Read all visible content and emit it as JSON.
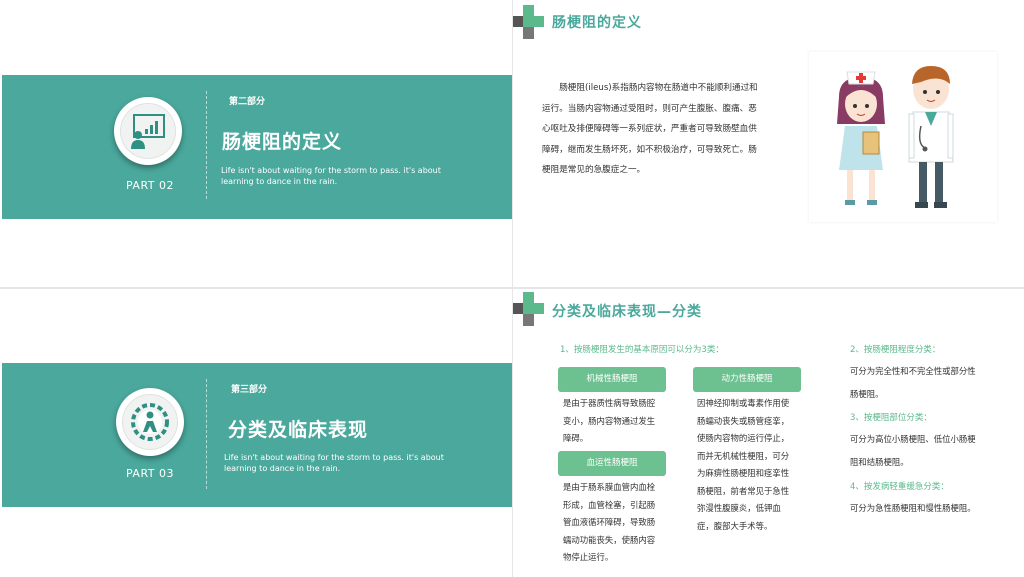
{
  "slide1": {
    "part": "PART 02",
    "label": "第二部分",
    "title": "肠梗阻的定义",
    "subtitle": "Life isn't about waiting for the storm to pass. it's about learning to dance in the rain.",
    "icon": "presenter-board-icon"
  },
  "slide2": {
    "title": "肠梗阻的定义",
    "paragraph": "肠梗阻(ileus)系指肠内容物在肠道中不能顺利通过和运行。当肠内容物通过受阻时，则可产生腹胀、腹痛、恶心呕吐及排便障碍等一系列症状，严重者可导致肠壁血供障碍，继而发生肠坏死，如不积极治疗，可导致死亡。肠梗阻是常见的急腹症之一。",
    "illustration": "nurse-and-doctor-illustration"
  },
  "slide3": {
    "part": "PART 03",
    "label": "第三部分",
    "title": "分类及临床表现",
    "subtitle": "Life isn't about waiting for the storm to pass. it's about learning to dance in the rain.",
    "icon": "person-gear-icon"
  },
  "slide4": {
    "title": "分类及临床表现—分类",
    "left_heading": "1、按肠梗阻发生的基本原因可以分为3类：",
    "pills": [
      "机械性肠梗阻",
      "动力性肠梗阻",
      "血运性肠梗阻"
    ],
    "mech_text": "是由于器质性病导致肠腔变小，肠内容物通过发生障碍。",
    "dyn_text": "因神经抑制或毒素作用使肠蠕动丧失或肠管痉挛，使肠内容物的运行停止，而并无机械性梗阻，可分为麻痹性肠梗阻和痉挛性肠梗阻，前者常见于急性弥漫性腹膜炎，低钾血症，腹部大手术等。",
    "vasc_text": "是由于肠系膜血管内血栓形成，血管栓塞，引起肠管血液循环障碍，导致肠蠕动功能丧失，使肠内容物停止运行。",
    "right": [
      {
        "heading": "2、按肠梗阻程度分类：",
        "text": "可分为完全性和不完全性或部分性肠梗阻。"
      },
      {
        "heading": "3、按梗阻部位分类：",
        "text": "可分为高位小肠梗阻、低位小肠梗阻和结肠梗阻。"
      },
      {
        "heading": "4、按发病轻重缓急分类：",
        "text": "可分为急性肠梗阻和慢性肠梗阻。"
      }
    ]
  },
  "colors": {
    "teal": "#4aa89c",
    "green": "#6dc08f",
    "dark_gray": "#555555"
  }
}
